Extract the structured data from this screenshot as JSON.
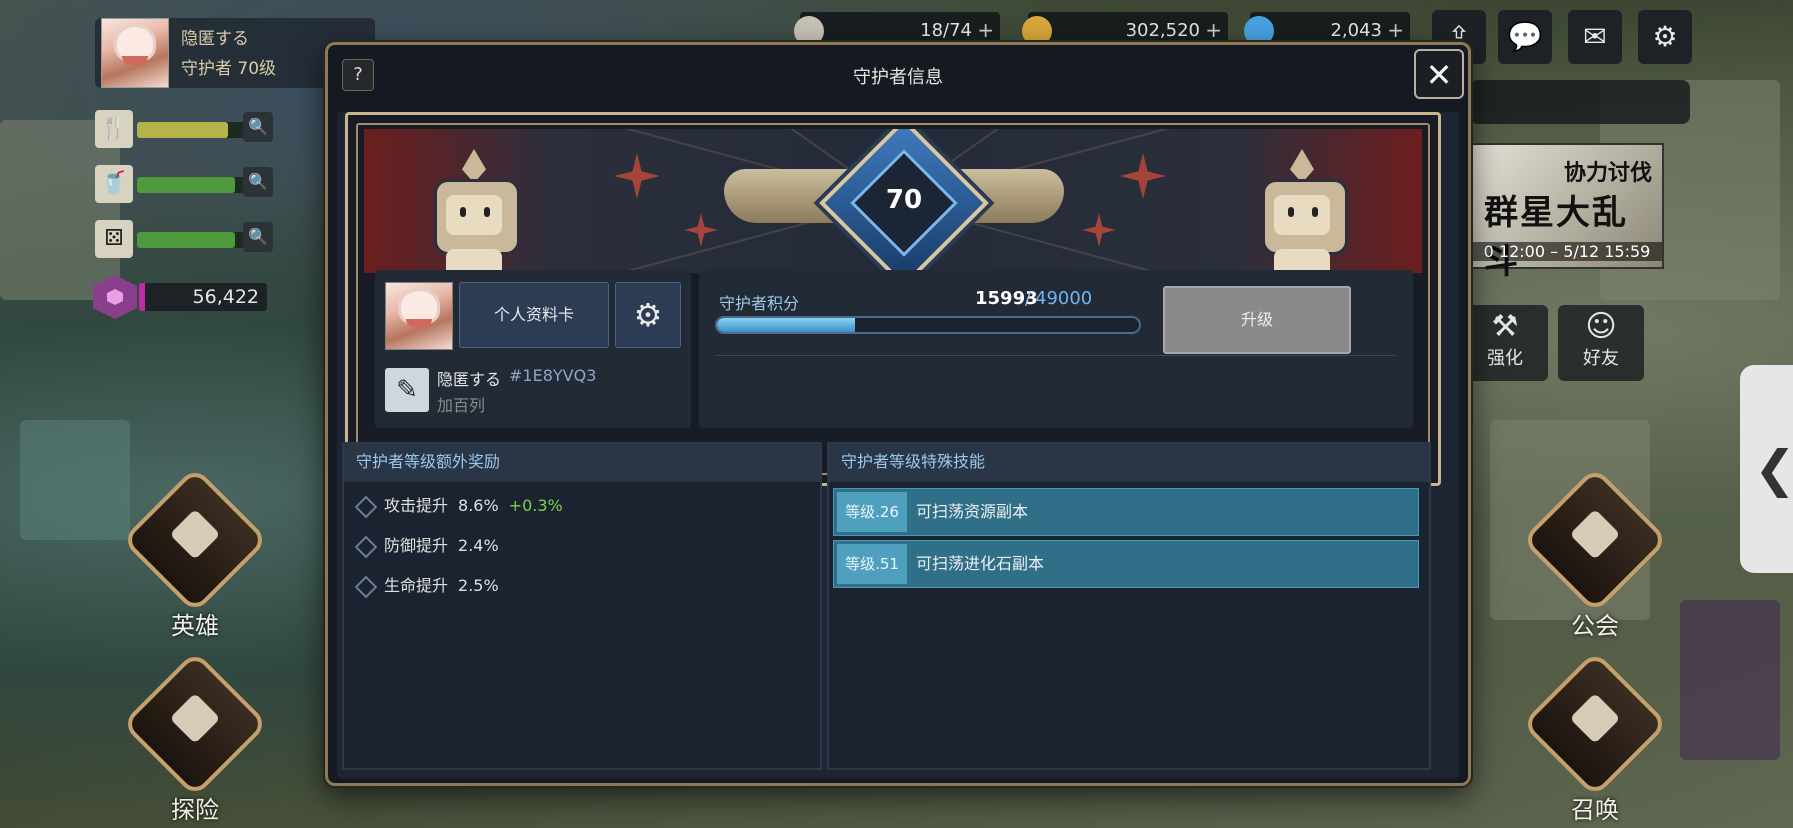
{
  "player": {
    "name": "隐匿する",
    "level_label": "守护者 70级"
  },
  "gems": {
    "value": "56,422"
  },
  "currencies": [
    {
      "value": "18/74",
      "plus": "+"
    },
    {
      "value": "302,520",
      "plus": "+"
    },
    {
      "value": "2,043",
      "plus": "+"
    }
  ],
  "top_icons": {
    "share": "⇪",
    "chat": "💬",
    "mail": "✉",
    "settings": "⚙"
  },
  "banner": {
    "tag": "协力讨伐",
    "title": "群星大乱斗",
    "dates": "0 12:00 – 5/12 15:59"
  },
  "right_menu": [
    {
      "label": "强化",
      "icon": "⚒"
    },
    {
      "label": "好友",
      "icon": "☺"
    }
  ],
  "side_tab": {
    "arrow": "❮"
  },
  "bottom_menu": {
    "heroes": "英雄",
    "explore": "探险",
    "guild": "公会",
    "summon": "召唤"
  },
  "modal": {
    "help": "?",
    "title": "守护者信息",
    "close": "✕",
    "level": "70",
    "profile": {
      "card_button": "个人资料卡",
      "settings_icon": "⚙",
      "edit_icon": "✎",
      "name": "隐匿する",
      "id": "#1E8YVQ3",
      "guild": "加百列"
    },
    "points": {
      "label": "守护者积分",
      "current": "15993",
      "slash": "/",
      "max": "49000",
      "progress_fraction": 0.326,
      "upgrade_button": "升级"
    },
    "bonus": {
      "title": "守护者等级额外奖励",
      "items": [
        {
          "name": "攻击提升",
          "value": "8.6%",
          "extra": "+0.3%"
        },
        {
          "name": "防御提升",
          "value": "2.4%",
          "extra": ""
        },
        {
          "name": "生命提升",
          "value": "2.5%",
          "extra": ""
        }
      ]
    },
    "skills": {
      "title": "守护者等级特殊技能",
      "items": [
        {
          "level": "等级.26",
          "name": "可扫荡资源副本"
        },
        {
          "level": "等级.51",
          "name": "可扫荡进化石副本"
        }
      ]
    }
  },
  "colors": {
    "accent_blue": "#6fb5f0",
    "bonus_green": "#7ad04c",
    "frame_gold": "#c9b48d"
  }
}
